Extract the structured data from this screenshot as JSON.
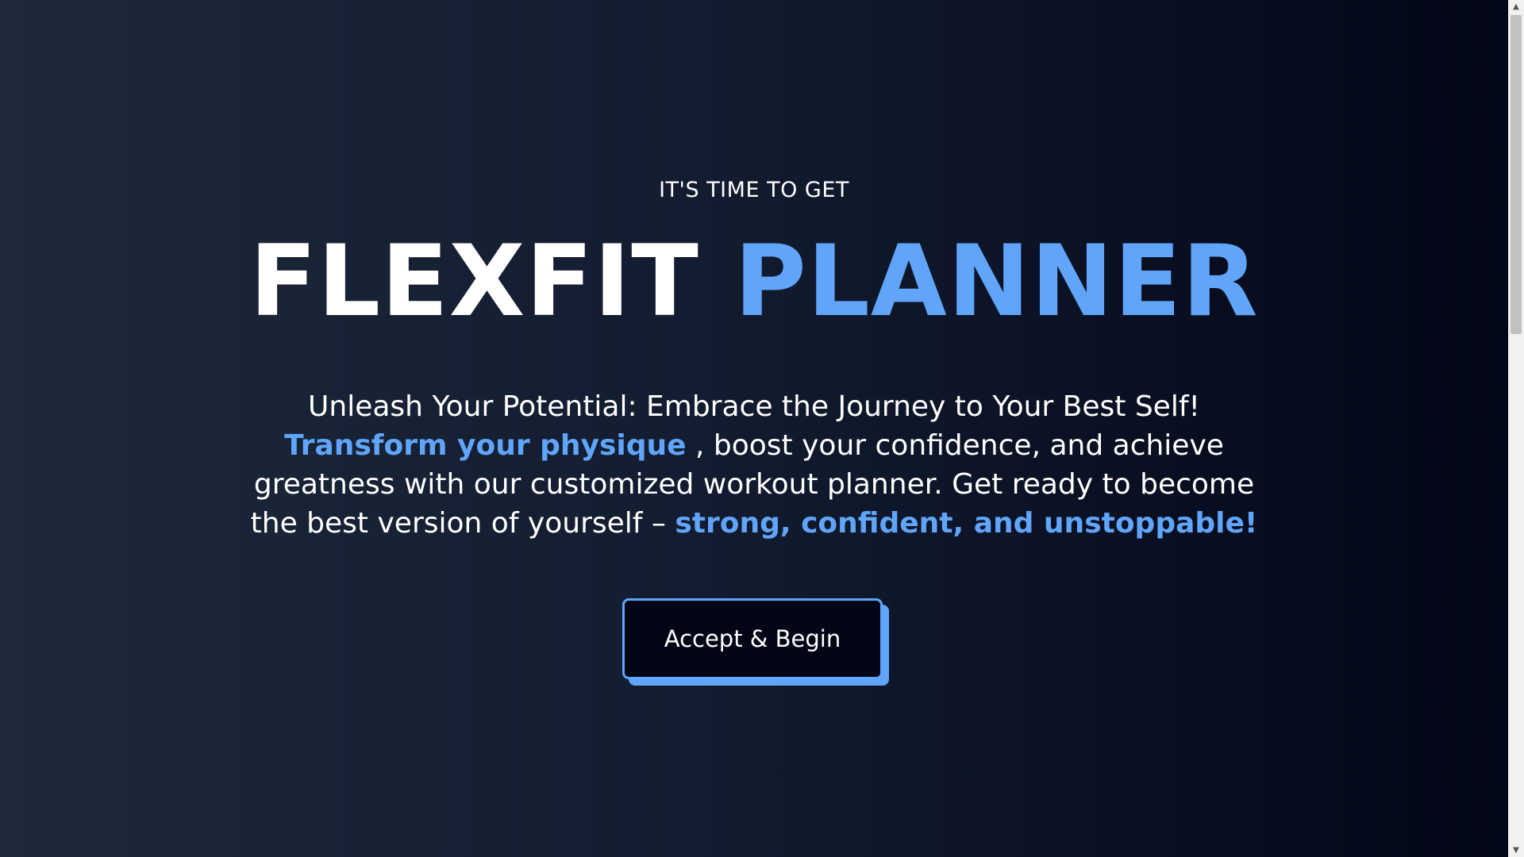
{
  "hero": {
    "eyebrow": "IT'S TIME TO GET",
    "title_main": "FLEXFIT",
    "title_accent": "PLANNER",
    "tagline_part1": "Unleash Your Potential: Embrace the Journey to Your Best Self! ",
    "tagline_highlight1": "Transform your physique",
    "tagline_part2": " , boost your confidence, and achieve greatness with our customized workout planner. Get ready to become the best version of yourself – ",
    "tagline_highlight2": "strong, confident, and unstoppable!"
  },
  "cta": {
    "label": "Accept & Begin"
  },
  "scrollbar": {
    "up_icon": "▲",
    "down_icon": "▼"
  },
  "colors": {
    "accent": "#60a5fa",
    "background_start": "#1e293b",
    "background_end": "#020617",
    "button_bg": "#020617"
  }
}
